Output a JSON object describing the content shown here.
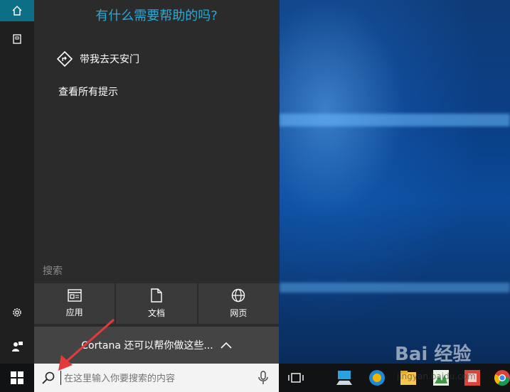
{
  "panel": {
    "heading": "有什么需要帮助的吗?",
    "suggestion": "带我去天安门",
    "all_tips": "查看所有提示",
    "search_label": "搜索",
    "categories": [
      {
        "label": "应用",
        "icon": "app-window-icon"
      },
      {
        "label": "文档",
        "icon": "document-icon"
      },
      {
        "label": "网页",
        "icon": "globe-icon"
      }
    ],
    "cortana_text": "Cortana 还可以帮你做这些..."
  },
  "rail": {
    "icons": [
      "home-icon",
      "notebook-icon",
      "settings-icon",
      "feedback-icon"
    ]
  },
  "taskbar": {
    "search_placeholder": "在这里输入你要搜索的内容",
    "icons": [
      "task-view-icon",
      "this-pc-icon",
      "blue-app-icon",
      "yellow-app-icon",
      "green-app-icon",
      "red-app-icon",
      "chrome-icon"
    ]
  },
  "watermark": {
    "brand": "Bai 经验",
    "url": "jingyan.baidu.com"
  },
  "colors": {
    "accent": "#29a9d8",
    "home_tile": "#0d6f86",
    "arrow": "#e33b3b"
  }
}
